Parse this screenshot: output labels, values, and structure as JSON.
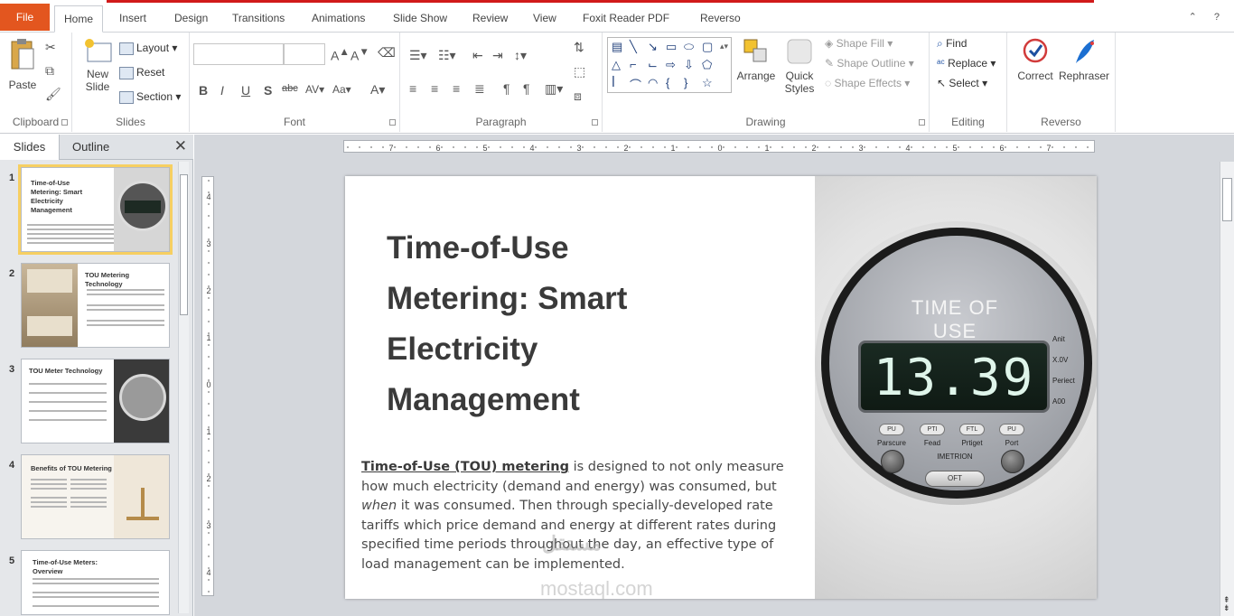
{
  "tabs": {
    "file": "File",
    "items": [
      "Home",
      "Insert",
      "Design",
      "Transitions",
      "Animations",
      "Slide Show",
      "Review",
      "View",
      "Foxit Reader PDF",
      "Reverso"
    ],
    "active": "Home"
  },
  "ribbon": {
    "clipboard": {
      "label": "Clipboard",
      "paste": "Paste"
    },
    "slides": {
      "label": "Slides",
      "new_slide_1": "New",
      "new_slide_2": "Slide",
      "layout": "Layout",
      "reset": "Reset",
      "section": "Section"
    },
    "font": {
      "label": "Font"
    },
    "paragraph": {
      "label": "Paragraph"
    },
    "drawing": {
      "label": "Drawing",
      "arrange": "Arrange",
      "quick_styles_1": "Quick",
      "quick_styles_2": "Styles",
      "shape_fill": "Shape Fill",
      "shape_outline": "Shape Outline",
      "shape_effects": "Shape Effects"
    },
    "editing": {
      "label": "Editing",
      "find": "Find",
      "replace": "Replace",
      "select": "Select"
    },
    "reverso": {
      "label": "Reverso",
      "correct": "Correct",
      "rephraser": "Rephraser"
    }
  },
  "pane": {
    "tab_slides": "Slides",
    "tab_outline": "Outline",
    "thumbnails": [
      {
        "num": "1",
        "title": "Time-of-Use Metering: Smart Electricity Management"
      },
      {
        "num": "2",
        "title": "TOU Metering Technology"
      },
      {
        "num": "3",
        "title": "TOU Meter Technology"
      },
      {
        "num": "4",
        "title": "Benefits of TOU Metering"
      },
      {
        "num": "5",
        "title": "Time-of-Use Meters: Overview"
      }
    ]
  },
  "slide": {
    "title_lines": [
      "Time-of-Use",
      "Metering: Smart",
      "Electricity",
      "Management"
    ],
    "body_link": "Time-of-Use (TOU) metering",
    "body_part1": " is designed to not only measure how much electricity (demand and energy) was consumed, but ",
    "body_italic": "when",
    "body_part2": " it was consumed. Then through specially-developed rate tariffs which price demand and energy at different rates during specified time periods throughout the day, an effective type of load management can be implemented.",
    "meter": {
      "label": "TIME OF USE",
      "display": "13.39",
      "side_labels": [
        "Anit",
        "X.0V",
        "Periect",
        "A00"
      ],
      "buttons": [
        "PU",
        "PTI",
        "FTL",
        "PU"
      ],
      "button_labels": [
        "Parscure",
        "Fead",
        "Prtiget",
        "Port"
      ],
      "brand": "IMETRION",
      "off": "OFT"
    }
  },
  "watermark": {
    "line1": "مستقل",
    "line2": "mostaql.com"
  },
  "colors": {
    "file_tab": "#e3561f",
    "accent_red": "#d11a1a",
    "selected_thumb": "#f6cf62"
  }
}
